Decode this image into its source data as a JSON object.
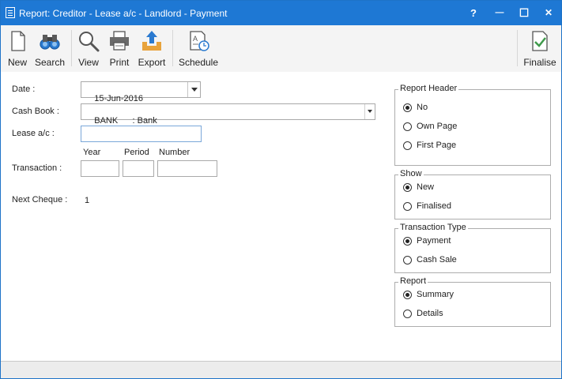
{
  "window": {
    "title": "Report: Creditor - Lease a/c - Landlord - Payment"
  },
  "titlebar": {
    "help": "?",
    "minimize": "—",
    "maximize": "☐",
    "close": "✕"
  },
  "toolbar": {
    "new": "New",
    "search": "Search",
    "view": "View",
    "print": "Print",
    "export": "Export",
    "schedule": "Schedule",
    "finalise": "Finalise"
  },
  "form": {
    "date_label": "Date :",
    "date_value": "15-Jun-2016",
    "cashbook_label": "Cash Book :",
    "cashbook_value": "BANK      : Bank",
    "lease_label": "Lease a/c :",
    "lease_value": "",
    "year_header": "Year",
    "period_header": "Period",
    "number_header": "Number",
    "transaction_label": "Transaction :",
    "year_value": "",
    "period_value": "",
    "number_value": "",
    "next_cheque_label": "Next Cheque :",
    "next_cheque_value": "1"
  },
  "report_header": {
    "title": "Report Header",
    "options": [
      "No",
      "Own Page",
      "First Page"
    ],
    "selected": "No"
  },
  "show": {
    "title": "Show",
    "options": [
      "New",
      "Finalised"
    ],
    "selected": "New"
  },
  "transaction_type": {
    "title": "Transaction Type",
    "options": [
      "Payment",
      "Cash Sale"
    ],
    "selected": "Payment"
  },
  "report": {
    "title": "Report",
    "options": [
      "Summary",
      "Details"
    ],
    "selected": "Summary"
  },
  "colors": {
    "titlebar": "#1e78d4",
    "toolbar_bg": "#f4f4f4",
    "accent_icon": "#2a7ad0",
    "export_icon": "#e8a33c",
    "finalise_icon": "#3f9a4b"
  }
}
